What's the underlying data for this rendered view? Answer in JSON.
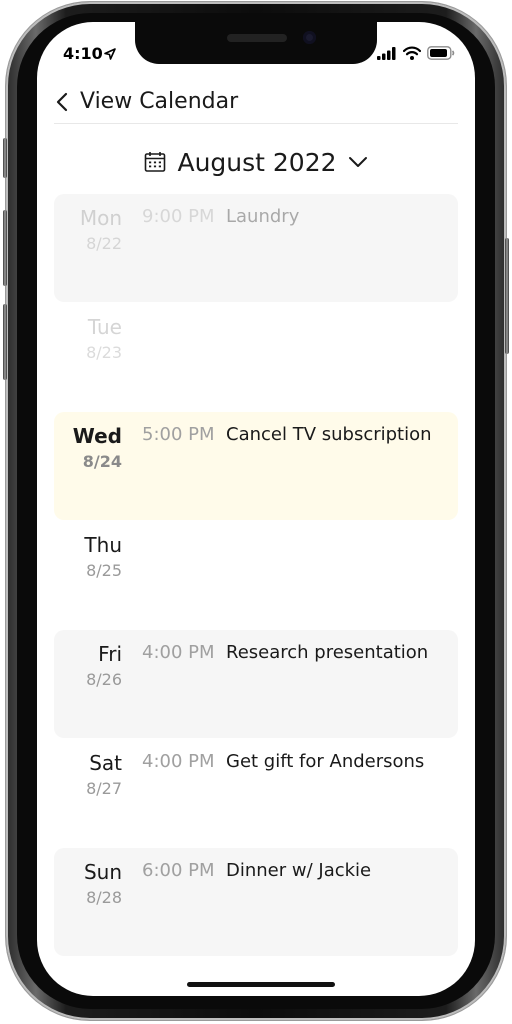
{
  "status": {
    "time": "4:10"
  },
  "header": {
    "back_label": "View Calendar"
  },
  "month": {
    "label": "August 2022"
  },
  "days": [
    {
      "name": "Mon",
      "date": "8/22",
      "event_time": "9:00 PM",
      "event_title": "Laundry"
    },
    {
      "name": "Tue",
      "date": "8/23",
      "event_time": "",
      "event_title": ""
    },
    {
      "name": "Wed",
      "date": "8/24",
      "event_time": "5:00 PM",
      "event_title": "Cancel TV subscription"
    },
    {
      "name": "Thu",
      "date": "8/25",
      "event_time": "",
      "event_title": ""
    },
    {
      "name": "Fri",
      "date": "8/26",
      "event_time": "4:00 PM",
      "event_title": "Research presentation"
    },
    {
      "name": "Sat",
      "date": "8/27",
      "event_time": "4:00 PM",
      "event_title": "Get gift for Andersons"
    },
    {
      "name": "Sun",
      "date": "8/28",
      "event_time": "6:00 PM",
      "event_title": "Dinner w/ Jackie"
    }
  ],
  "colors": {
    "today_bg": "#fffbea",
    "shaded_bg": "#f6f6f6",
    "muted_text": "#9a9a9a"
  }
}
